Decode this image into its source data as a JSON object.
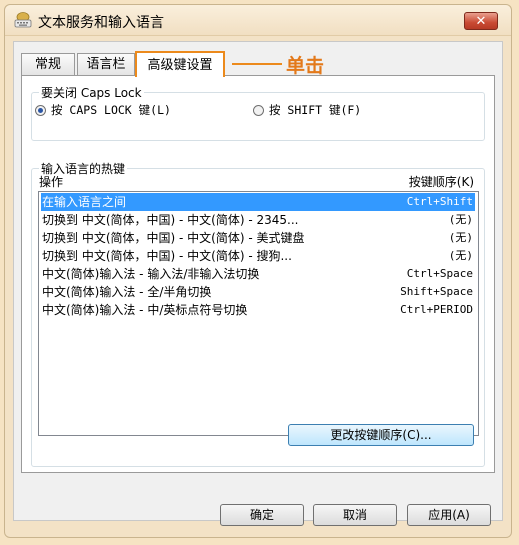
{
  "window": {
    "title": "文本服务和输入语言",
    "close_label": "✕"
  },
  "tabs": [
    {
      "label": "常规"
    },
    {
      "label": "语言栏"
    },
    {
      "label": "高级键设置"
    }
  ],
  "annotation": {
    "text": "单击",
    "color": "#ec8a1c"
  },
  "caps_group": {
    "label": "要关闭 Caps Lock",
    "option1": "按 CAPS LOCK 键(L)",
    "option2": "按 SHIFT 键(F)",
    "selected": "option1"
  },
  "hotkey_group": {
    "label": "输入语言的热键",
    "col_action": "操作",
    "col_key": "按键顺序(K)",
    "rows": [
      {
        "action": "在输入语言之间",
        "key": "Ctrl+Shift",
        "selected": true
      },
      {
        "action": "切换到 中文(简体，中国) - 中文(简体) - 2345...",
        "key": "(无)"
      },
      {
        "action": "切换到 中文(简体，中国) - 中文(简体) - 美式键盘",
        "key": "(无)"
      },
      {
        "action": "切换到 中文(简体，中国) - 中文(简体) - 搜狗...",
        "key": "(无)"
      },
      {
        "action": "中文(简体)输入法 - 输入法/非输入法切换",
        "key": "Ctrl+Space"
      },
      {
        "action": "中文(简体)输入法 - 全/半角切换",
        "key": "Shift+Space"
      },
      {
        "action": "中文(简体)输入法 - 中/英标点符号切换",
        "key": "Ctrl+PERIOD"
      }
    ],
    "change_button": "更改按键顺序(C)..."
  },
  "footer": {
    "ok": "确定",
    "cancel": "取消",
    "apply": "应用(A)"
  }
}
